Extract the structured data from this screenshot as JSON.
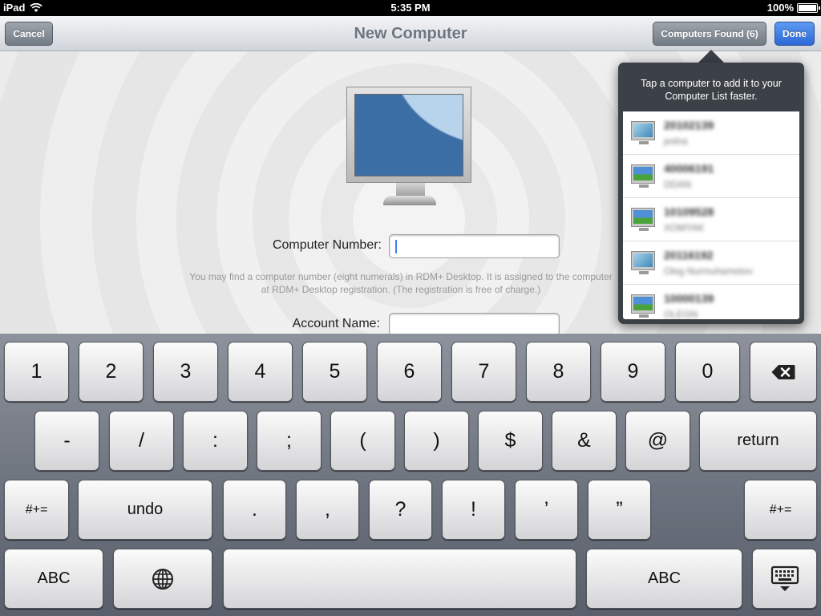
{
  "status": {
    "carrier": "iPad",
    "time": "5:35 PM",
    "battery": "100%",
    "battery_level": 1.0
  },
  "nav": {
    "title": "New Computer",
    "cancel": "Cancel",
    "found": "Computers Found (6)",
    "done": "Done"
  },
  "form": {
    "computer_number_label": "Computer Number:",
    "computer_number_value": "",
    "hint": "You may find a computer number (eight numerals) in RDM+ Desktop. It is assigned to the computer at RDM+ Desktop registration. (The registration is free of charge.)",
    "account_name_label": "Account Name:",
    "account_name_value": ""
  },
  "popover": {
    "header": "Tap a computer to add it to your Computer List faster.",
    "computers": [
      {
        "number": "20102139",
        "owner": "polna",
        "icon": "monitor-icon-blue"
      },
      {
        "number": "40006191",
        "owner": "DDAN",
        "icon": "monitor-icon-xp"
      },
      {
        "number": "10109528",
        "owner": "XOMYAK",
        "icon": "monitor-icon-xp"
      },
      {
        "number": "20116192",
        "owner": "Oleg Nurmuhametov",
        "icon": "monitor-icon-blue"
      },
      {
        "number": "10000139",
        "owner": "OLEGN",
        "icon": "monitor-icon-xp"
      }
    ]
  },
  "keyboard": {
    "row1": [
      "1",
      "2",
      "3",
      "4",
      "5",
      "6",
      "7",
      "8",
      "9",
      "0"
    ],
    "row2": [
      "-",
      "/",
      ":",
      ";",
      "(",
      ")",
      "$",
      "&",
      "@"
    ],
    "row2_return": "return",
    "row3_left": "#+=",
    "row3_undo": "undo",
    "row3": [
      ".",
      ",",
      "?",
      "!",
      "’",
      "”"
    ],
    "row3_right": "#+=",
    "row4_abc_left": "ABC",
    "row4_abc_right": "ABC"
  },
  "colors": {
    "done_blue": "#2e68d6",
    "caret_blue": "#3c7ff2",
    "popover_bg": "#3c4047"
  }
}
